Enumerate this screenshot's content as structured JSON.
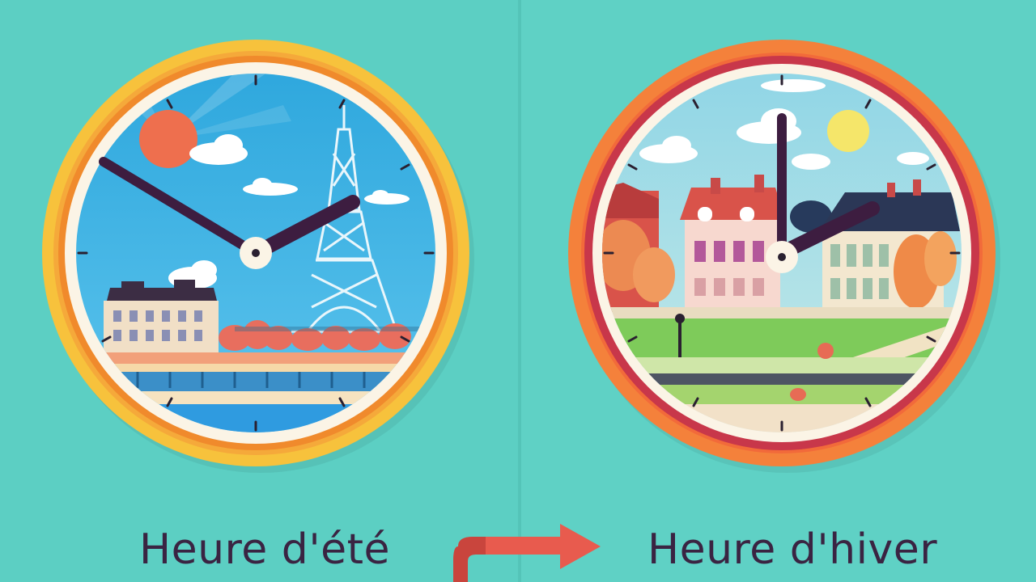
{
  "labels": {
    "summer": "Heure d'été",
    "winter": "Heure d'hiver"
  },
  "colors": {
    "background": "#5ccfc3",
    "summer_ring_outer": "#f7c23c",
    "summer_ring_inner": "#f08a2c",
    "winter_ring_outer": "#f4813b",
    "winter_ring_inner": "#c8374a",
    "hands": "#3d1d40",
    "arrow": "#e85b4e",
    "text": "#3a2442"
  },
  "icons": {
    "summer_clock": "summer-paris-clock-icon",
    "winter_clock": "autumn-town-clock-icon",
    "transition_arrow": "right-arrow-icon"
  }
}
